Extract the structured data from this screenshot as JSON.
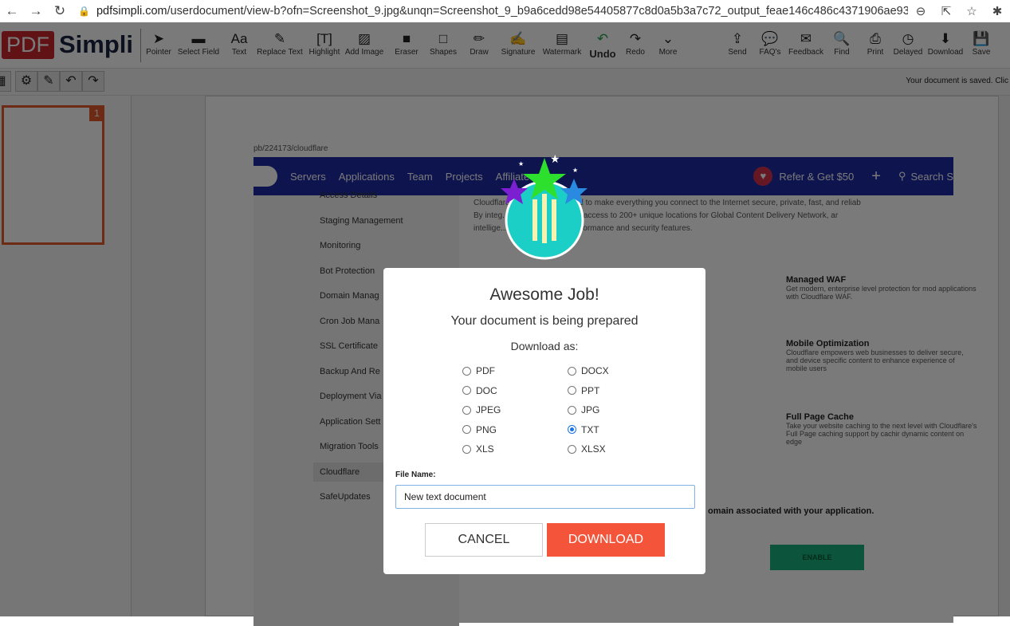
{
  "browser": {
    "url_host": "pdfsimpli.com",
    "url_path": "/userdocument/view-b?ofn=Screenshot_9.jpg&unqn=Screenshot_9_b9a6cedd98e54405877c8d0a5b3a7c72_output_feae146c486c4371906ae9390c3..."
  },
  "logo": {
    "pdf": "PDF",
    "simpli": "Simpli"
  },
  "tools": [
    {
      "label": "Pointer",
      "icon": "pointer-icon",
      "g": "➤"
    },
    {
      "label": "Select Field",
      "icon": "select-field-icon",
      "g": "▬"
    },
    {
      "label": "Text",
      "icon": "text-icon",
      "g": "Aa"
    },
    {
      "label": "Replace Text",
      "icon": "replace-text-icon",
      "g": "✎"
    },
    {
      "label": "Highlight",
      "icon": "highlight-icon",
      "g": "[T]"
    },
    {
      "label": "Add Image",
      "icon": "image-icon",
      "g": "▨"
    },
    {
      "label": "Eraser",
      "icon": "eraser-icon",
      "g": "■"
    },
    {
      "label": "Shapes",
      "icon": "shapes-icon",
      "g": "□"
    },
    {
      "label": "Draw",
      "icon": "pencil-icon",
      "g": "✏"
    },
    {
      "label": "Signature",
      "icon": "signature-icon",
      "g": "✍"
    },
    {
      "label": "Watermark",
      "icon": "watermark-icon",
      "g": "▤"
    },
    {
      "label": "Undo",
      "icon": "undo-icon",
      "g": "↶"
    },
    {
      "label": "Redo",
      "icon": "redo-icon",
      "g": "↷"
    },
    {
      "label": "More",
      "icon": "chevrons-down-icon",
      "g": "⌄"
    },
    {
      "label": "Send",
      "icon": "share-icon",
      "g": "⇪"
    },
    {
      "label": "FAQ's",
      "icon": "chat-icon",
      "g": "💬"
    },
    {
      "label": "Feedback",
      "icon": "feedback-icon",
      "g": "✉"
    },
    {
      "label": "Find",
      "icon": "search-icon",
      "g": "🔍"
    },
    {
      "label": "Print",
      "icon": "print-icon",
      "g": "⎙"
    },
    {
      "label": "Delayed",
      "icon": "clock-icon",
      "g": "◷"
    },
    {
      "label": "Download",
      "icon": "download-icon",
      "g": "⬇"
    },
    {
      "label": "Save",
      "icon": "save-icon",
      "g": "💾"
    }
  ],
  "status": "Your document is saved. Clic",
  "thumb_page": "1",
  "doc": {
    "breadcrumb": "pb/224173/cloudflare",
    "nav": [
      "Servers",
      "Applications",
      "Team",
      "Projects",
      "Affiliate"
    ],
    "refer": "Refer & Get $50",
    "search": "Search S",
    "side": [
      "Access Details",
      "Staging Management",
      "Monitoring",
      "Bot Protection",
      "Domain Manag",
      "Cron Job Mana",
      "SSL Certificate",
      "Backup And Re",
      "Deployment Via",
      "Application Sett",
      "Migration Tools",
      "Cloudflare",
      "SafeUpdates"
    ],
    "intro": [
      "Cloudflare ... network designed to make everything you connect to the Internet secure, private, fast, and reliab",
      "By integ... enterprise, you gain access to 200+ unique locations for Global Content Delivery Network, ar",
      "intellige... along with many performance and security features."
    ],
    "features": [
      {
        "title": "Managed WAF",
        "text": "Get modern, enterprise level protection for mod applications with Cloudflare WAF."
      },
      {
        "title": "Mobile Optimization",
        "text": "Cloudflare empowers web businesses to deliver secure, and device specific content to enhance experience of mobile users"
      },
      {
        "title": "Full Page Cache",
        "text": "Take your website caching to the next level with Cloudflare's Full Page caching support by cachir dynamic content on edge"
      }
    ],
    "domain_text": "omain associated with your application.",
    "enable": "ENABLE"
  },
  "modal": {
    "title": "Awesome Job!",
    "subtitle": "Your document is being prepared",
    "download_as": "Download as:",
    "options": [
      {
        "label": "PDF",
        "checked": false
      },
      {
        "label": "DOCX",
        "checked": false
      },
      {
        "label": "DOC",
        "checked": false
      },
      {
        "label": "PPT",
        "checked": false
      },
      {
        "label": "JPEG",
        "checked": false
      },
      {
        "label": "JPG",
        "checked": false
      },
      {
        "label": "PNG",
        "checked": false
      },
      {
        "label": "TXT",
        "checked": true
      },
      {
        "label": "XLS",
        "checked": false
      },
      {
        "label": "XLSX",
        "checked": false
      }
    ],
    "file_name_label": "File Name:",
    "file_name": "New text document",
    "cancel": "CANCEL",
    "download": "DOWNLOAD",
    "colors": {
      "download": "#f4553a",
      "badge": "#1ccfc6"
    }
  }
}
